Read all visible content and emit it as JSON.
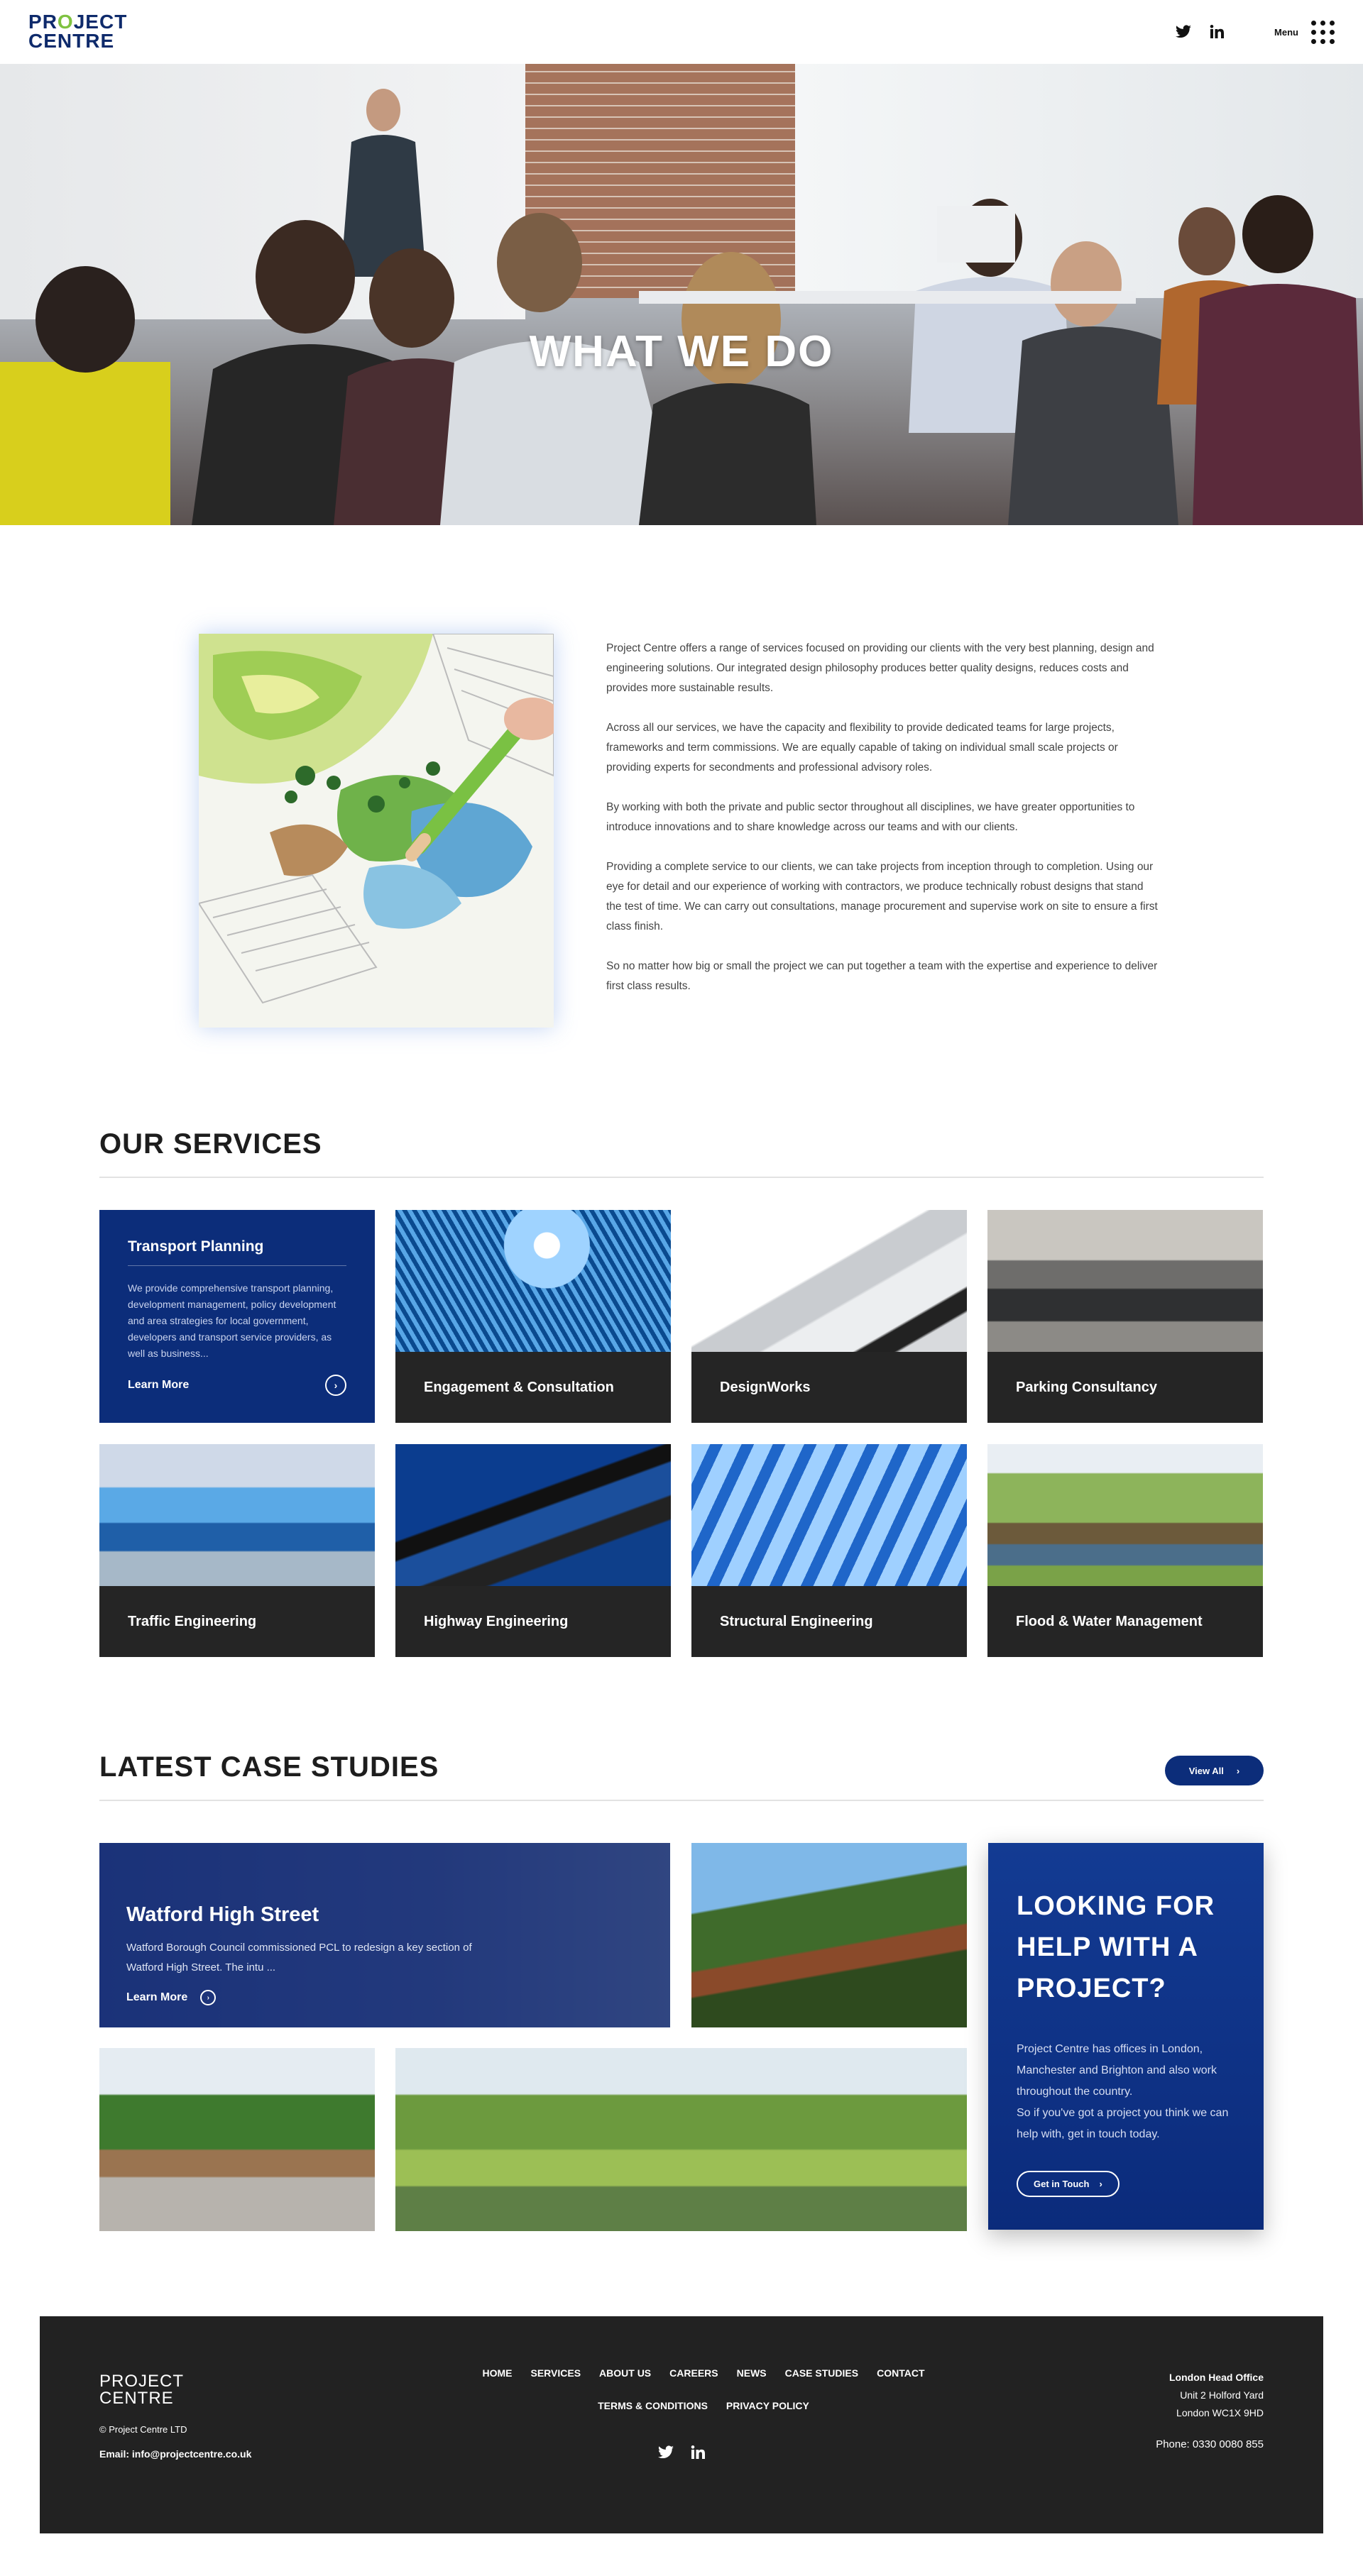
{
  "header": {
    "logo_line1": "PROJECT",
    "logo_line2": "CENTRE",
    "social": [
      "twitter-icon",
      "linkedin-icon"
    ],
    "menu_label": "Menu"
  },
  "hero": {
    "title": "WHAT WE DO"
  },
  "intro": {
    "paragraphs": [
      "Project Centre offers a range of services focused on providing our clients with the very best planning, design and engineering solutions. Our integrated design philosophy produces better quality designs, reduces costs and provides more sustainable results.",
      "Across all our services, we have the capacity and flexibility to provide dedicated teams for large projects, frameworks and term commissions. We are equally capable of taking on individual small scale projects or providing experts for secondments and professional advisory roles.",
      "By working with both the private and public sector throughout all disciplines, we have greater opportunities to introduce innovations and to share knowledge across our teams and with our clients.",
      "Providing a complete service to our clients, we can take projects from inception through to completion. Using our eye for detail and our experience of working with contractors, we produce technically robust designs that stand the test of time. We can carry out consultations, manage procurement and supervise work on site to ensure a first class finish.",
      "So no matter how big or small the project we can put together a team with the expertise and experience to deliver first class results."
    ]
  },
  "services": {
    "title": "OUR SERVICES",
    "featured": {
      "title": "Transport Planning",
      "text": "We provide comprehensive transport planning, development management, policy development and area strategies for local government, developers and transport service providers, as well as business...",
      "link": "Learn More"
    },
    "cards": [
      "Engagement & Consultation",
      "DesignWorks",
      "Parking Consultancy",
      "Traffic Engineering",
      "Highway Engineering",
      "Structural Engineering",
      "Flood & Water Management"
    ]
  },
  "case_studies": {
    "title": "LATEST CASE STUDIES",
    "view_all": "View All",
    "main": {
      "title": "Watford High Street",
      "text": "Watford Borough Council commissioned PCL to redesign a key section of Watford High Street. The intu ...",
      "link": "Learn More"
    },
    "cta": {
      "title": "LOOKING FOR HELP WITH A PROJECT?",
      "text1": "Project Centre has offices in London, Manchester and Brighton and also work throughout the country.",
      "text2": "So if you've got a project you think we can help with, get in touch today.",
      "button": "Get in Touch"
    }
  },
  "footer": {
    "logo_line1": "PROJECT",
    "logo_line2": "CENTRE",
    "copyright": "© Project Centre LTD",
    "email": "Email: info@projectcentre.co.uk",
    "nav_row1": [
      "HOME",
      "SERVICES",
      "ABOUT US",
      "CAREERS",
      "NEWS",
      "CASE STUDIES",
      "CONTACT"
    ],
    "nav_row2": [
      "TERMS & CONDITIONS",
      "PRIVACY POLICY"
    ],
    "office_title": "London Head Office",
    "office_line1": "Unit 2 Holford Yard",
    "office_line2": "London WC1X 9HD",
    "phone": "Phone: 0330 0080 855"
  }
}
